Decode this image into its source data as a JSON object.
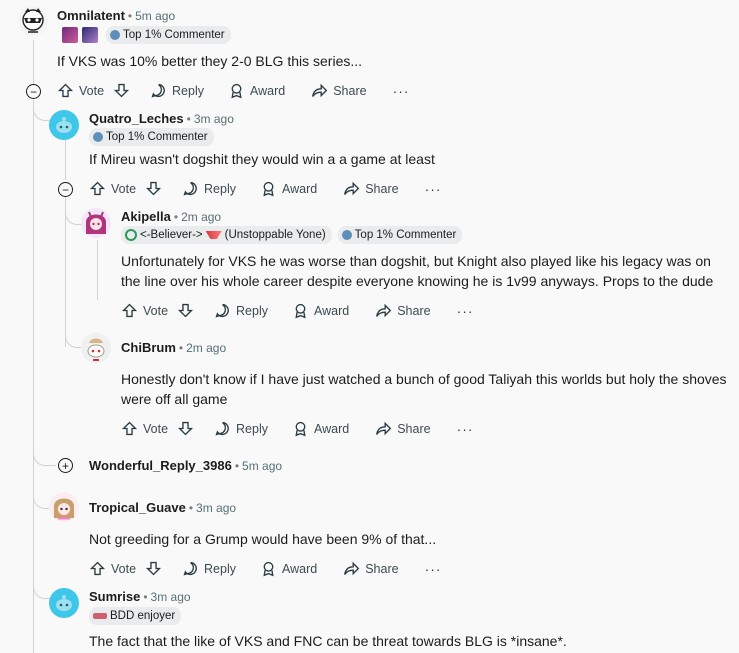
{
  "comments": [
    {
      "author": "Omnilatent",
      "time": "5m ago",
      "flair": "Top 1% Commenter",
      "body": "If VKS was 10% better they 2-0 BLG this series..."
    },
    {
      "author": "Quatro_Leches",
      "time": "3m ago",
      "flair": "Top 1% Commenter",
      "body": "If Mireu wasn't dogshit they would win a a game at least"
    },
    {
      "author": "Akipella",
      "time": "2m ago",
      "flair_team": "<-Believer->",
      "flair_team2": "(Unstoppable Yone)",
      "flair": "Top 1% Commenter",
      "body": "Unfortunately for VKS he was worse than dogshit, but Knight also played like his legacy was on the line over his whole career despite everyone knowing he is 1v99 anyways. Props to the dude"
    },
    {
      "author": "ChiBrum",
      "time": "2m ago",
      "body": "Honestly don't know if I have just watched a bunch of good Taliyah this worlds but holy the shoves were off all game"
    },
    {
      "author": "Wonderful_Reply_3986",
      "time": "5m ago"
    },
    {
      "author": "Tropical_Guave",
      "time": "3m ago",
      "body": "Not greeding for a Grump would have been 9% of that..."
    },
    {
      "author": "Sumrise",
      "time": "3m ago",
      "flair": "BDD enjoyer",
      "body": "The fact that the like of VKS and FNC can be threat towards BLG is *insane*."
    }
  ],
  "actions": {
    "vote": "Vote",
    "reply": "Reply",
    "award": "Award",
    "share": "Share",
    "more": "···"
  },
  "icons": {
    "collapse": "minus-circle",
    "expand": "plus-circle"
  }
}
